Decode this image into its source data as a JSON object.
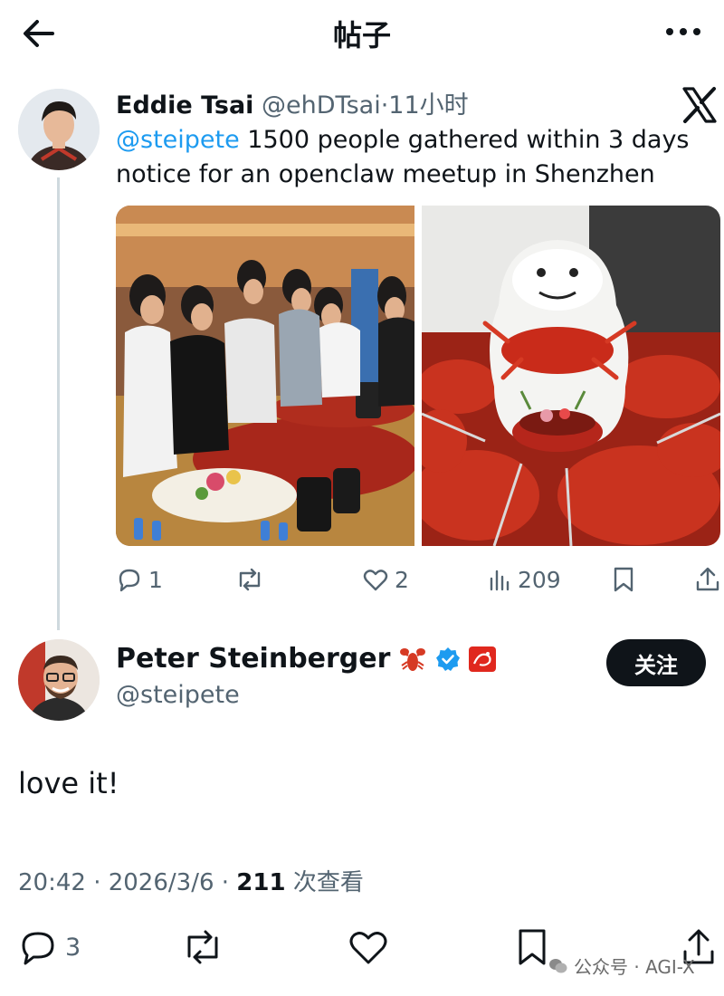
{
  "header": {
    "title": "帖子",
    "back_icon": "arrow-left-icon",
    "more_icon": "more-horizontal-icon"
  },
  "quoted": {
    "name": "Eddie Tsai",
    "handle": "@ehDTsai",
    "dot": "·",
    "time": "11小时",
    "mention": "@steipete",
    "text": " 1500 people gathered within 3 days notice for an openclaw meetup in Shenzhen",
    "actions": {
      "replies": "1",
      "reposts": "",
      "likes": "2",
      "views": "209"
    }
  },
  "post": {
    "author_name": "Peter Steinberger",
    "author_handle": "@steipete",
    "follow_label": "关注",
    "text": "love it!",
    "meta_time": "20:42 · 2026/3/6 · ",
    "meta_views_count": "211",
    "meta_views_label": " 次查看",
    "actions": {
      "replies": "3"
    }
  },
  "watermark": {
    "text": "公众号 · AGI-X"
  },
  "colors": {
    "accent": "#1d9bf0",
    "text": "#0f1419",
    "muted": "#536471",
    "verified": "#1d9bf0",
    "follow_bg": "#0f1419"
  }
}
